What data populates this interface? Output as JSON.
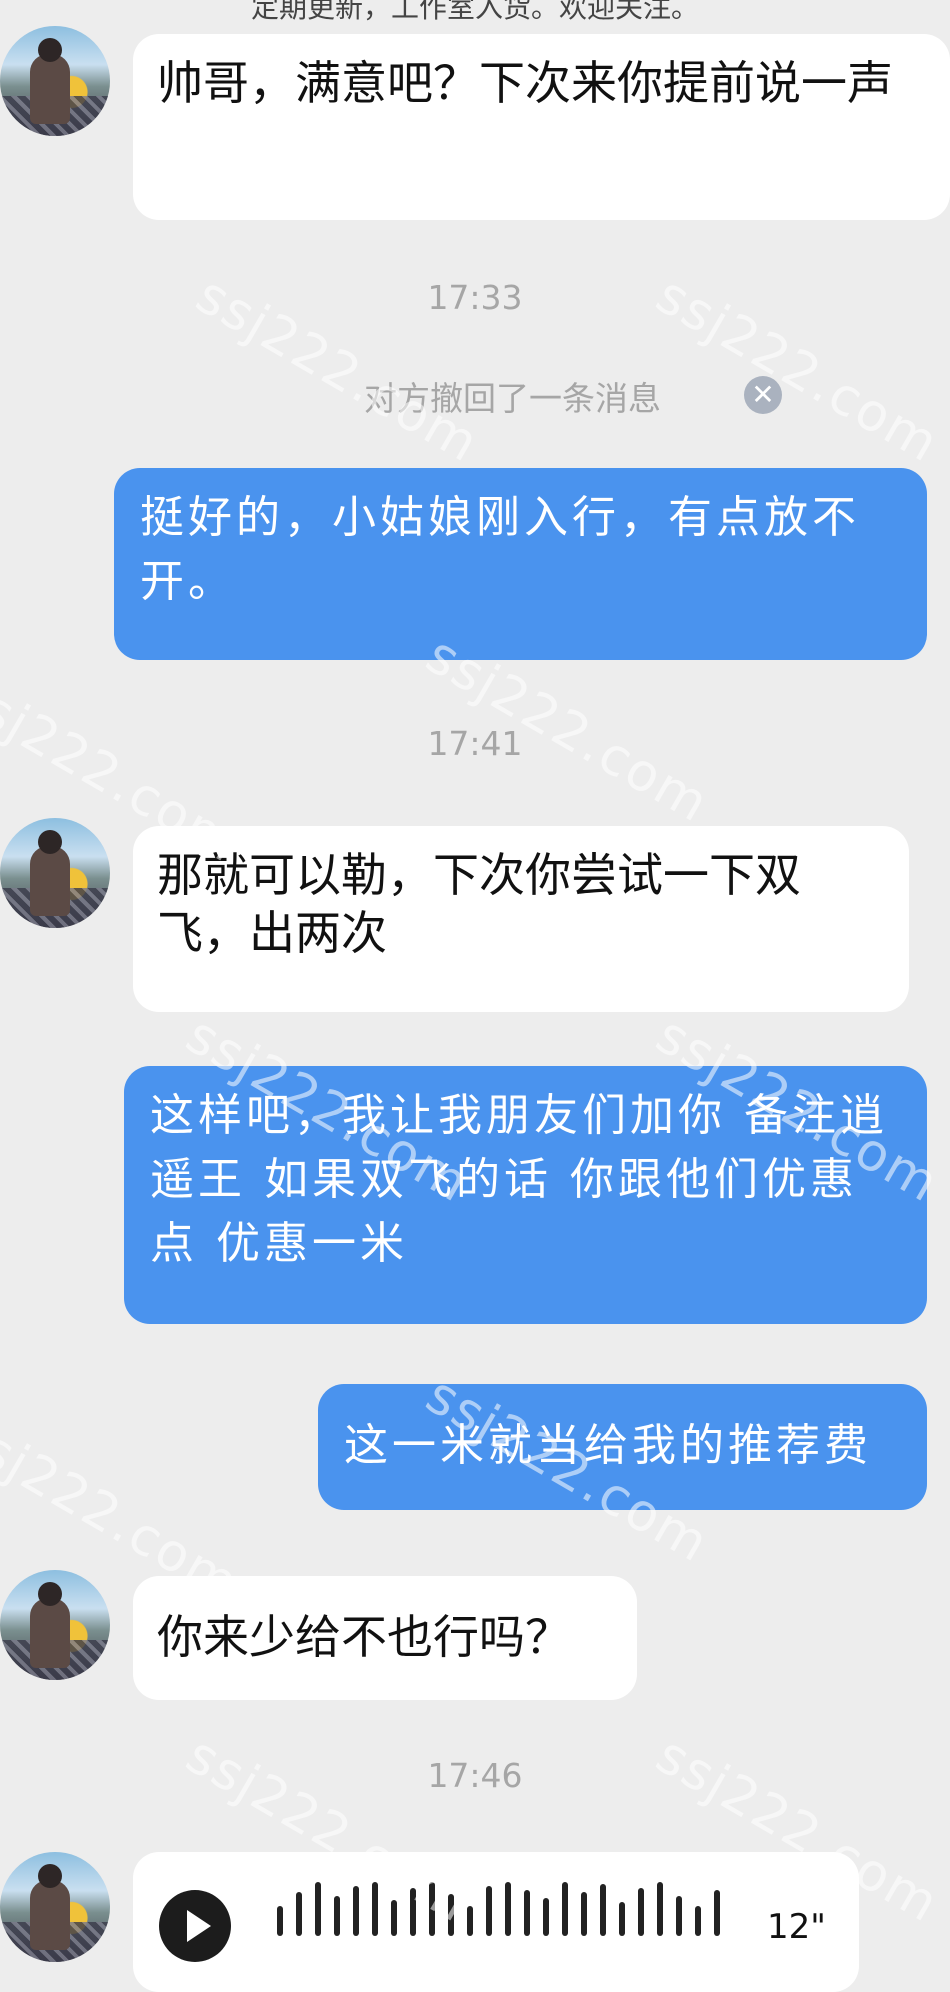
{
  "top_notice": "定期更新，工作室入货。欢迎关注。",
  "messages": {
    "m1": "帅哥，满意吧？下次来你提前说一声",
    "t1": "17:33",
    "recall": "对方撤回了一条消息",
    "m2": "挺好的，小姑娘刚入行，有点放不开。",
    "t2": "17:41",
    "m3": "那就可以勒，下次你尝试一下双飞，出两次",
    "m4": "这样吧，我让我朋友们加你 备注逍遥王 如果双飞的话 你跟他们优惠点 优惠一米",
    "m5": "这一米就当给我的推荐费",
    "m6": "你来少给不也行吗？",
    "t3": "17:46",
    "voice_duration": "12\""
  },
  "watermark": "ssj222.com",
  "icons": {
    "recall_close": "close-icon",
    "voice_play": "play-icon"
  },
  "colors": {
    "background": "#ededed",
    "outgoing_bubble": "#4a93ee",
    "incoming_bubble": "#ffffff",
    "timestamp": "#a6a6a6"
  }
}
